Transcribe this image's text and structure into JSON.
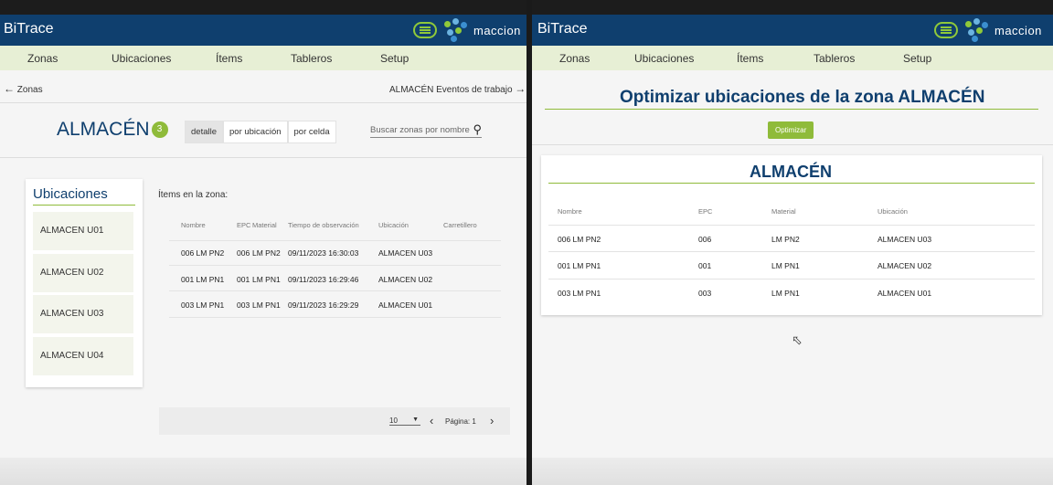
{
  "left": {
    "brand": "BiTrace",
    "logo_text": "maccion",
    "nav": [
      "Zonas",
      "Ubicaciones",
      "Ítems",
      "Tableros",
      "Setup"
    ],
    "back_link": "Zonas",
    "events_link": "ALMACÉN Eventos de trabajo",
    "zone_title": "ALMACÉN",
    "zone_count": "3",
    "tabs": [
      "detalle",
      "por ubicación",
      "por celda"
    ],
    "search_placeholder": "Buscar zonas por nombre",
    "locations_title": "Ubicaciones",
    "locations": [
      "ALMACEN U01",
      "ALMACEN U02",
      "ALMACEN U03",
      "ALMACEN U04"
    ],
    "items_title": "Ítems en la zona:",
    "columns": [
      "Nombre",
      "EPC",
      "Material",
      "Tiempo de observación",
      "Ubicación",
      "Carretillero"
    ],
    "rows": [
      {
        "nombre": "006 LM PN2",
        "epc": "006",
        "material": "LM PN2",
        "tiempo": "09/11/2023 16:30:03",
        "ubicacion": "ALMACEN U03"
      },
      {
        "nombre": "001 LM PN1",
        "epc": "001",
        "material": "LM PN1",
        "tiempo": "09/11/2023 16:29:46",
        "ubicacion": "ALMACEN U02"
      },
      {
        "nombre": "003 LM PN1",
        "epc": "003",
        "material": "LM PN1",
        "tiempo": "09/11/2023 16:29:29",
        "ubicacion": "ALMACEN U01"
      }
    ],
    "page_size": "10",
    "page_label": "Página: 1"
  },
  "right": {
    "brand": "BiTrace",
    "logo_text": "maccion",
    "nav": [
      "Zonas",
      "Ubicaciones",
      "Ítems",
      "Tableros",
      "Setup"
    ],
    "heading": "Optimizar ubicaciones de la zona ALMACÉN",
    "optimize_button": "Optimizar",
    "card_title": "ALMACÉN",
    "columns": [
      "Nombre",
      "EPC",
      "Material",
      "Ubicación"
    ],
    "rows": [
      {
        "nombre": "006 LM PN2",
        "epc": "006",
        "material": "LM PN2",
        "ubicacion": "ALMACEN U03"
      },
      {
        "nombre": "001 LM PN1",
        "epc": "001",
        "material": "LM PN1",
        "ubicacion": "ALMACEN U02"
      },
      {
        "nombre": "003 LM PN1",
        "epc": "003",
        "material": "LM PN1",
        "ubicacion": "ALMACEN U01"
      }
    ]
  },
  "colors": {
    "header": "#0f3f6e",
    "accent": "#8fbb3a",
    "nav_bg": "#e7efd5"
  }
}
